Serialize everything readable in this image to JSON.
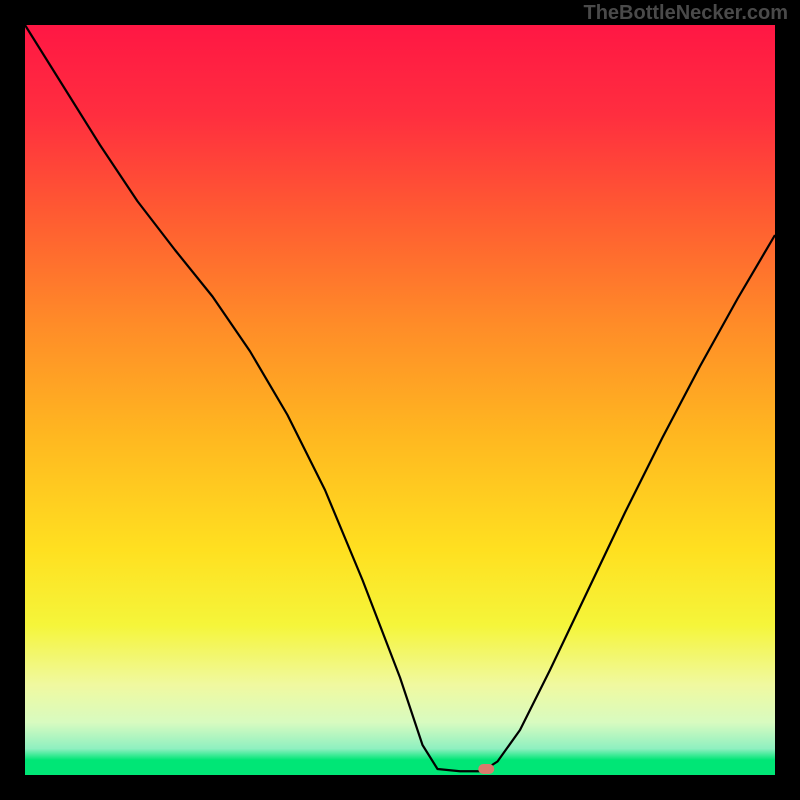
{
  "watermark": "TheBottleNecker.com",
  "chart_data": {
    "type": "line",
    "title": "",
    "xlabel": "",
    "ylabel": "",
    "xlim": [
      0,
      100
    ],
    "ylim": [
      0,
      100
    ],
    "gradient_stops": [
      {
        "offset": 0,
        "color": "#ff1744"
      },
      {
        "offset": 12,
        "color": "#ff2e3f"
      },
      {
        "offset": 25,
        "color": "#ff5a32"
      },
      {
        "offset": 40,
        "color": "#ff8c28"
      },
      {
        "offset": 55,
        "color": "#ffb820"
      },
      {
        "offset": 70,
        "color": "#ffe020"
      },
      {
        "offset": 80,
        "color": "#f5f53a"
      },
      {
        "offset": 88,
        "color": "#f0f9a0"
      },
      {
        "offset": 93,
        "color": "#d8fbc0"
      },
      {
        "offset": 96.5,
        "color": "#8ef0c0"
      },
      {
        "offset": 98,
        "color": "#00e676"
      },
      {
        "offset": 100,
        "color": "#00e676"
      }
    ],
    "curve": [
      {
        "x": 0.0,
        "y": 100.0
      },
      {
        "x": 5.0,
        "y": 92.0
      },
      {
        "x": 10.0,
        "y": 84.0
      },
      {
        "x": 15.0,
        "y": 76.5
      },
      {
        "x": 20.0,
        "y": 70.0
      },
      {
        "x": 25.0,
        "y": 63.8
      },
      {
        "x": 30.0,
        "y": 56.5
      },
      {
        "x": 35.0,
        "y": 48.0
      },
      {
        "x": 40.0,
        "y": 38.0
      },
      {
        "x": 45.0,
        "y": 26.0
      },
      {
        "x": 50.0,
        "y": 13.0
      },
      {
        "x": 53.0,
        "y": 4.0
      },
      {
        "x": 55.0,
        "y": 0.8
      },
      {
        "x": 58.0,
        "y": 0.5
      },
      {
        "x": 61.0,
        "y": 0.5
      },
      {
        "x": 63.0,
        "y": 1.8
      },
      {
        "x": 66.0,
        "y": 6.0
      },
      {
        "x": 70.0,
        "y": 14.0
      },
      {
        "x": 75.0,
        "y": 24.5
      },
      {
        "x": 80.0,
        "y": 35.0
      },
      {
        "x": 85.0,
        "y": 45.0
      },
      {
        "x": 90.0,
        "y": 54.5
      },
      {
        "x": 95.0,
        "y": 63.5
      },
      {
        "x": 100.0,
        "y": 72.0
      }
    ],
    "marker": {
      "x": 61.5,
      "y": 0.8,
      "color": "#d97b6c"
    }
  }
}
